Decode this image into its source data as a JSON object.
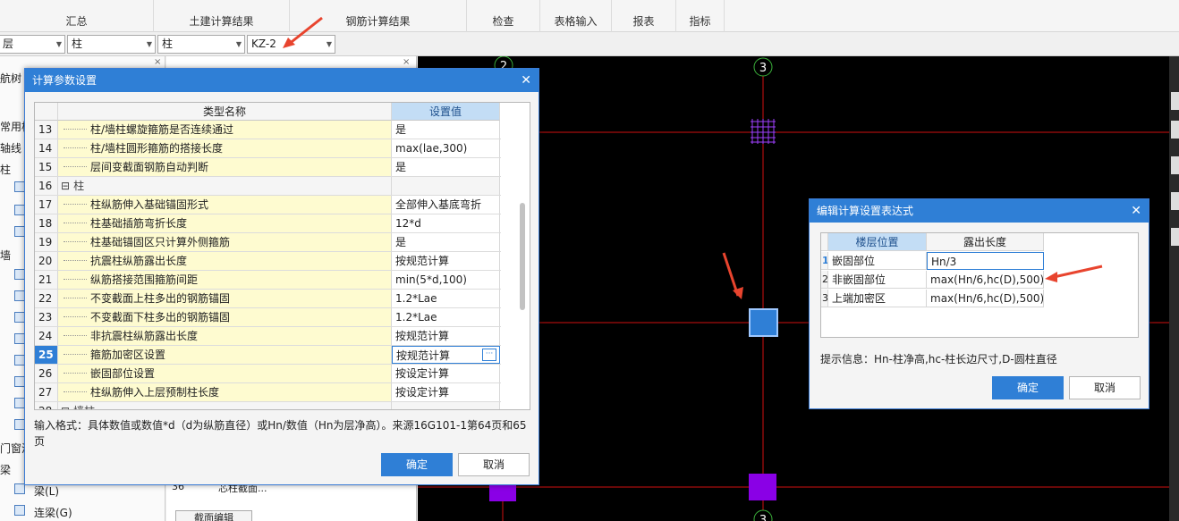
{
  "ribbon": {
    "tabs": [
      "汇总",
      "土建计算结果",
      "钢筋计算结果",
      "检查",
      "表格输入",
      "报表",
      "指标"
    ]
  },
  "selectors": {
    "floor": "层",
    "category": "柱",
    "type": "柱",
    "component": "KZ-2"
  },
  "left_panel": {
    "title_fragment": "航树",
    "items": [
      "常用构",
      "轴线",
      "柱",
      "墙",
      "门窗洞",
      "梁",
      "梁(L)",
      "连梁(G)"
    ]
  },
  "mid_panel": {
    "row_number": "36",
    "row_text": "芯柱截面...",
    "bottom_button": "截面编辑"
  },
  "canvas": {
    "axis_labels": [
      "2",
      "3",
      "3"
    ]
  },
  "calc_dialog": {
    "title": "计算参数设置",
    "col_name": "类型名称",
    "col_value": "设置值",
    "rows": [
      {
        "num": "13",
        "name": "柱/墙柱螺旋箍筋是否连续通过",
        "value": "是"
      },
      {
        "num": "14",
        "name": "柱/墙柱圆形箍筋的搭接长度",
        "value": "max(lae,300)"
      },
      {
        "num": "15",
        "name": "层间变截面钢筋自动判断",
        "value": "是"
      },
      {
        "num": "16",
        "name": "柱",
        "value": "",
        "group": true
      },
      {
        "num": "17",
        "name": "柱纵筋伸入基础锚固形式",
        "value": "全部伸入基底弯折"
      },
      {
        "num": "18",
        "name": "柱基础插筋弯折长度",
        "value": "12*d"
      },
      {
        "num": "19",
        "name": "柱基础锚固区只计算外侧箍筋",
        "value": "是"
      },
      {
        "num": "20",
        "name": "抗震柱纵筋露出长度",
        "value": "按规范计算"
      },
      {
        "num": "21",
        "name": "纵筋搭接范围箍筋间距",
        "value": "min(5*d,100)"
      },
      {
        "num": "22",
        "name": "不变截面上柱多出的钢筋锚固",
        "value": "1.2*Lae"
      },
      {
        "num": "23",
        "name": "不变截面下柱多出的钢筋锚固",
        "value": "1.2*Lae"
      },
      {
        "num": "24",
        "name": "非抗震柱纵筋露出长度",
        "value": "按规范计算"
      },
      {
        "num": "25",
        "name": "箍筋加密区设置",
        "value": "按规范计算",
        "selected": true
      },
      {
        "num": "26",
        "name": "嵌固部位设置",
        "value": "按设定计算"
      },
      {
        "num": "27",
        "name": "柱纵筋伸入上层预制柱长度",
        "value": "按设定计算"
      },
      {
        "num": "28",
        "name": "墙柱",
        "value": "",
        "group": true
      }
    ],
    "hint": "输入格式：具体数值或数值*d（d为纵筋直径）或Hn/数值（Hn为层净高）。来源16G101-1第64页和65页",
    "ok": "确定",
    "cancel": "取消"
  },
  "expr_dialog": {
    "title": "编辑计算设置表达式",
    "col_position": "楼层位置",
    "col_length": "露出长度",
    "rows": [
      {
        "num": "1",
        "position": "嵌固部位",
        "length": "Hn/3"
      },
      {
        "num": "2",
        "position": "非嵌固部位",
        "length": "max(Hn/6,hc(D),500)"
      },
      {
        "num": "3",
        "position": "上端加密区",
        "length": "max(Hn/6,hc(D),500)"
      }
    ],
    "hint": "提示信息：Hn-柱净高,hc-柱长边尺寸,D-圆柱直径",
    "ok": "确定",
    "cancel": "取消"
  },
  "colors": {
    "accent": "#2f7fd6",
    "name_cell_bg": "#fefbd0",
    "canvas_bg": "#000000",
    "axis_line": "#d01010",
    "column_fill": "#8a00e6",
    "selected_column": "#2f7fd6",
    "annotation_arrow": "#e8442e"
  }
}
